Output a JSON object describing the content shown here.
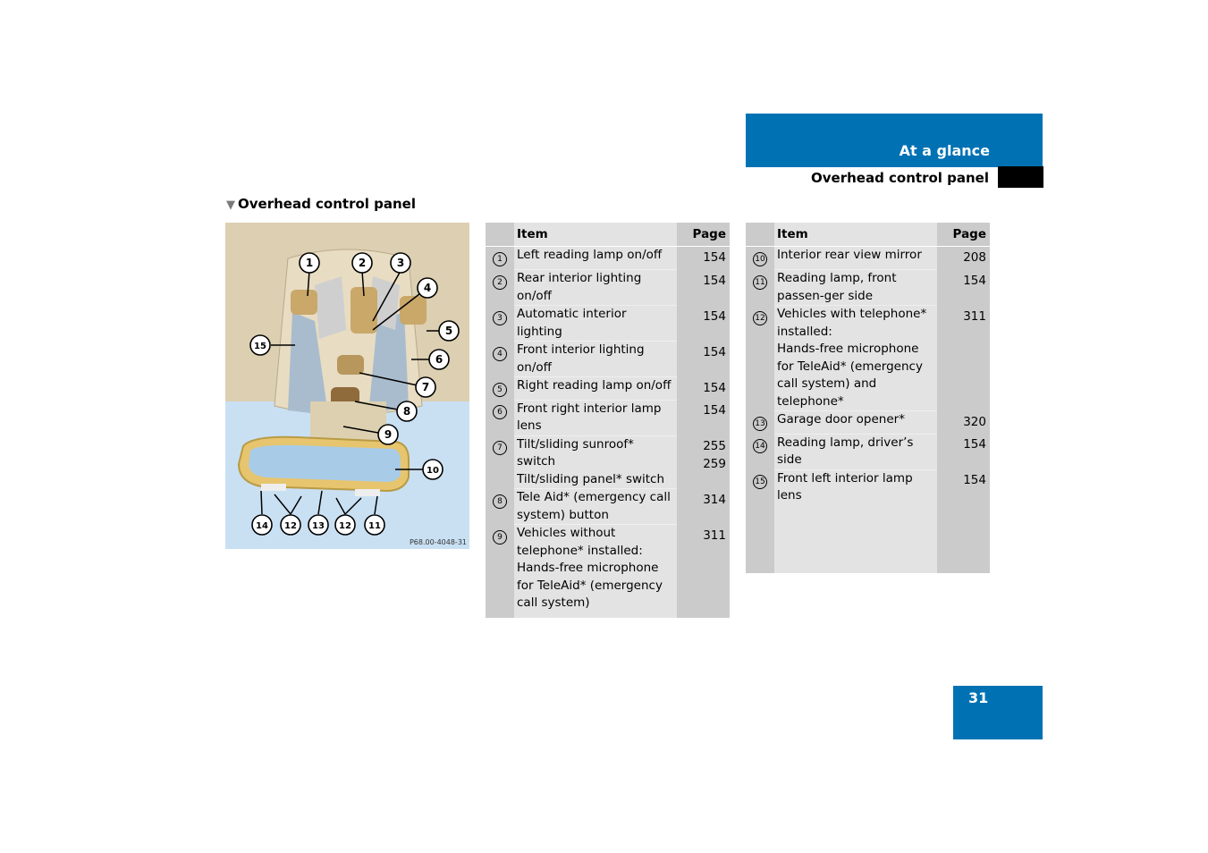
{
  "header": {
    "chapter": "At a glance",
    "section": "Overhead control panel"
  },
  "section_title": "Overhead control panel",
  "section_marker_icon": "triangle-down-icon",
  "figure": {
    "caption": "P68.00-4048-31",
    "callouts": [
      "1",
      "2",
      "3",
      "4",
      "5",
      "6",
      "7",
      "8",
      "9",
      "10",
      "14",
      "12",
      "13",
      "12",
      "11",
      "15"
    ]
  },
  "table_left": {
    "headers": {
      "item": "Item",
      "page": "Page"
    },
    "rows": [
      {
        "num": "1",
        "item": "Left reading lamp on/off",
        "page": "154"
      },
      {
        "num": "2",
        "item": "Rear interior lighting on/off",
        "page": "154"
      },
      {
        "num": "3",
        "item": "Automatic interior lighting",
        "page": "154"
      },
      {
        "num": "4",
        "item": "Front interior lighting on/off",
        "page": "154"
      },
      {
        "num": "5",
        "item": "Right reading lamp on/off",
        "page": "154"
      },
      {
        "num": "6",
        "item": "Front right interior lamp lens",
        "page": "154"
      },
      {
        "num": "7",
        "item": "Tilt/sliding sunroof* switch\nTilt/sliding panel* switch",
        "page": "255\n259"
      },
      {
        "num": "8",
        "item": "Tele Aid* (emergency call system) button",
        "page": "314"
      },
      {
        "num": "9",
        "item": "Vehicles without telephone* installed:\nHands-free microphone for TeleAid* (emergency call system)",
        "page": "311"
      }
    ]
  },
  "table_right": {
    "headers": {
      "item": "Item",
      "page": "Page"
    },
    "rows": [
      {
        "num": "10",
        "item": "Interior rear view mirror",
        "page": "208"
      },
      {
        "num": "11",
        "item": "Reading lamp, front passen-ger side",
        "page": "154"
      },
      {
        "num": "12",
        "item": "Vehicles with telephone* installed:\nHands-free microphone for TeleAid* (emergency call system) and telephone*",
        "page": "311"
      },
      {
        "num": "13",
        "item": "Garage door opener*",
        "page": "320"
      },
      {
        "num": "14",
        "item": "Reading lamp, driver’s side",
        "page": "154"
      },
      {
        "num": "15",
        "item": "Front left interior lamp lens",
        "page": "154"
      }
    ]
  },
  "page_number": "31",
  "colors": {
    "accent": "#0072b4",
    "table_dark": "#cbcbcb",
    "table_light": "#e3e3e3"
  }
}
